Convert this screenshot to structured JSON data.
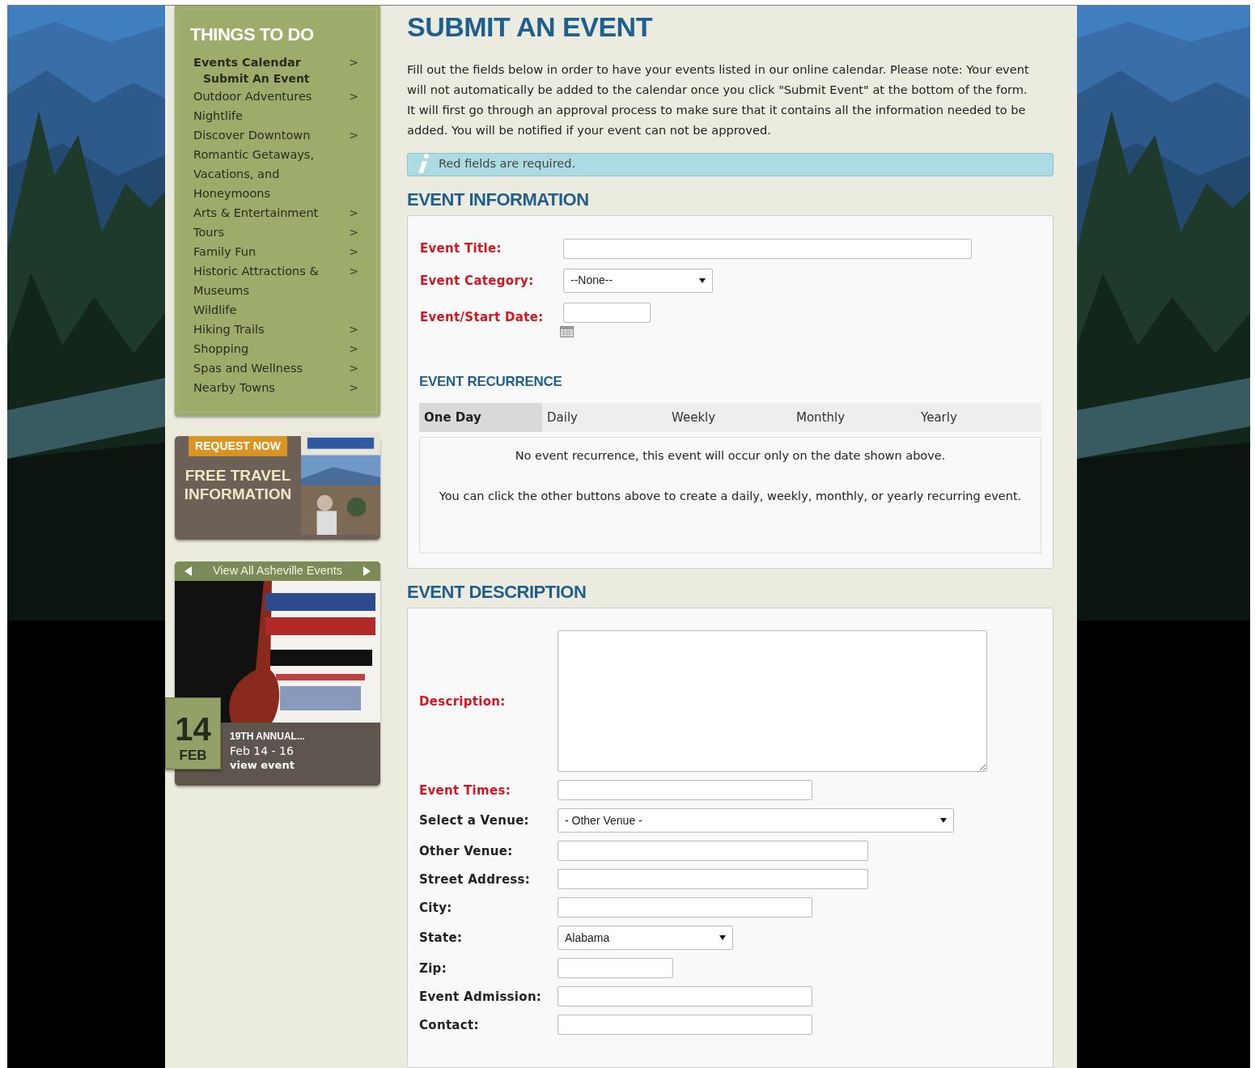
{
  "sidebar": {
    "title": "THINGS TO DO",
    "items": [
      {
        "label": "Events Calendar",
        "selected": true,
        "arrow": ">",
        "children": [
          {
            "label": "Submit An Event",
            "selected": true
          }
        ]
      },
      {
        "label": "Outdoor Adventures",
        "selected": false,
        "arrow": ">"
      },
      {
        "label": "Nightlife",
        "selected": false
      },
      {
        "label": "Discover Downtown",
        "selected": false,
        "arrow": ">"
      },
      {
        "label": "Romantic Getaways, Vacations, and Honeymoons",
        "selected": false
      },
      {
        "label": "Arts & Entertainment",
        "selected": false,
        "arrow": ">"
      },
      {
        "label": "Tours",
        "selected": false,
        "arrow": ">"
      },
      {
        "label": "Family Fun",
        "selected": false,
        "arrow": ">"
      },
      {
        "label": "Historic Attractions & Museums",
        "selected": false,
        "arrow": ">"
      },
      {
        "label": "Wildlife",
        "selected": false
      },
      {
        "label": "Hiking Trails",
        "selected": false,
        "arrow": ">"
      },
      {
        "label": "Shopping",
        "selected": false,
        "arrow": ">"
      },
      {
        "label": "Spas and Wellness",
        "selected": false,
        "arrow": ">"
      },
      {
        "label": "Nearby Towns",
        "selected": false,
        "arrow": ">"
      }
    ]
  },
  "promo": {
    "badge": "REQUEST NOW",
    "title": "FREE TRAVEL INFORMATION"
  },
  "events_widget": {
    "header": "View All Asheville Events",
    "day": "14",
    "month": "FEB",
    "title": "19TH ANNUAL...",
    "dates": "Feb 14 - 16",
    "link": "view event"
  },
  "main": {
    "title": "SUBMIT AN EVENT",
    "intro": "Fill out the fields below in order to have your events listed in our online calendar. Please note: Your event will not automatically be added to the calendar once you click \"Submit Event\" at the bottom of the form. It will first go through an approval process to make sure that it contains all the information needed to be added. You will be notified if your event can not be approved.",
    "notice": "Red fields are required.",
    "event_information": {
      "heading": "EVENT INFORMATION",
      "fields": [
        {
          "label": "Event Title:",
          "required": true,
          "kind": "text"
        },
        {
          "label": "Event Category:",
          "required": true,
          "kind": "select",
          "value": "--None--"
        },
        {
          "label": "Event/Start Date:",
          "required": true,
          "kind": "date"
        }
      ],
      "recurrence": {
        "heading": "EVENT RECURRENCE",
        "tabs": [
          {
            "label": "One Day",
            "selected": true
          },
          {
            "label": "Daily",
            "selected": false
          },
          {
            "label": "Weekly",
            "selected": false
          },
          {
            "label": "Monthly",
            "selected": false
          },
          {
            "label": "Yearly",
            "selected": false
          }
        ],
        "paragraphs": [
          "No event recurrence, this event will occur only on the date shown above.",
          "You can click the other buttons above to create a daily, weekly, monthly, or yearly recurring event."
        ]
      }
    },
    "event_description": {
      "heading": "EVENT DESCRIPTION",
      "fields": [
        {
          "label": "Description:",
          "required": true,
          "kind": "textarea"
        },
        {
          "label": "Event Times:",
          "required": true,
          "kind": "text"
        },
        {
          "label": "Select a Venue:",
          "required": false,
          "kind": "select",
          "value": "- Other Venue -"
        },
        {
          "label": "Other Venue:",
          "required": false,
          "kind": "text"
        },
        {
          "label": "Street Address:",
          "required": false,
          "kind": "text"
        },
        {
          "label": "City:",
          "required": false,
          "kind": "text"
        },
        {
          "label": "State:",
          "required": false,
          "kind": "select",
          "value": "Alabama"
        },
        {
          "label": "Zip:",
          "required": false,
          "kind": "text"
        },
        {
          "label": "Event Admission:",
          "required": false,
          "kind": "text"
        },
        {
          "label": "Contact:",
          "required": false,
          "kind": "text"
        }
      ]
    }
  }
}
